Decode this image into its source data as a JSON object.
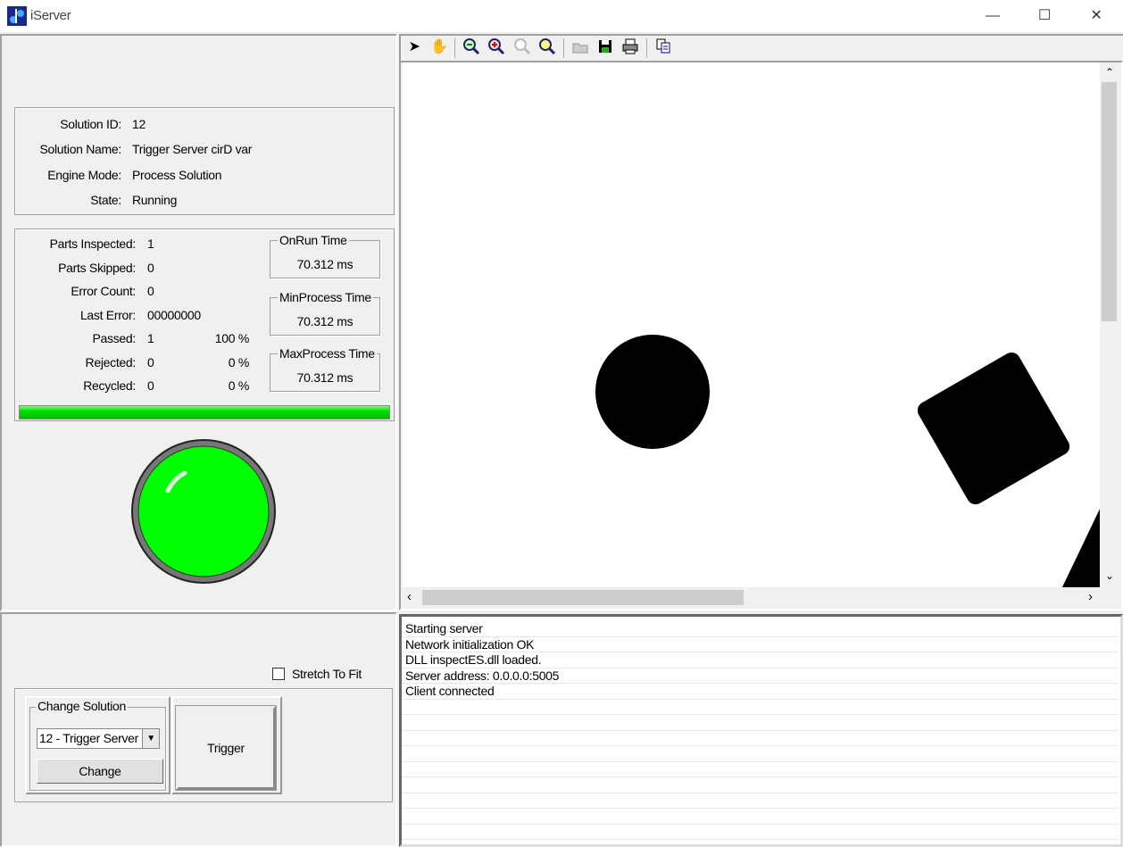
{
  "window": {
    "title": "iServer",
    "minimize": "—",
    "maximize": "☐",
    "close": "✕"
  },
  "toolbar": {
    "icons": [
      "pointer-icon",
      "pan-hand-icon",
      "zoom-out-icon",
      "zoom-in-icon",
      "zoom-100-icon",
      "zoom-fit-icon",
      "open-folder-icon",
      "save-icon",
      "print-icon",
      "copy-icon"
    ]
  },
  "solution": {
    "id_label": "Solution ID:",
    "id": "12",
    "name_label": "Solution Name:",
    "name": "Trigger Server cirD var",
    "mode_label": "Engine Mode:",
    "mode": "Process Solution",
    "state_label": "State:",
    "state": "Running"
  },
  "stats": {
    "rows": [
      {
        "label": "Parts Inspected:",
        "value": "1",
        "pct": ""
      },
      {
        "label": "Parts Skipped:",
        "value": "0",
        "pct": ""
      },
      {
        "label": "Error Count:",
        "value": "0",
        "pct": ""
      },
      {
        "label": "Last Error:",
        "value": "00000000",
        "pct": ""
      },
      {
        "label": "Passed:",
        "value": "1",
        "pct": "100 %"
      },
      {
        "label": "Rejected:",
        "value": "0",
        "pct": "0 %"
      },
      {
        "label": "Recycled:",
        "value": "0",
        "pct": "0 %"
      }
    ],
    "onrun": {
      "title": "OnRun Time",
      "value": "70.312 ms"
    },
    "minproc": {
      "title": "MinProcess Time",
      "value": "70.312 ms"
    },
    "maxproc": {
      "title": "MaxProcess Time",
      "value": "70.312 ms"
    },
    "progress_percent": 100,
    "progress_color": "#00e000"
  },
  "indicator": {
    "status": "pass",
    "color": "#00ff00"
  },
  "controls": {
    "stretch_label": "Stretch To Fit",
    "stretch_checked": false,
    "change_group": "Change Solution",
    "solution_select": "12 - Trigger Server",
    "change_button": "Change",
    "trigger_button": "Trigger"
  },
  "log": [
    "Starting server",
    "Network initialization OK",
    "DLL inspectES.dll loaded.",
    "Server address: 0.0.0.0:5005",
    "Client connected"
  ]
}
